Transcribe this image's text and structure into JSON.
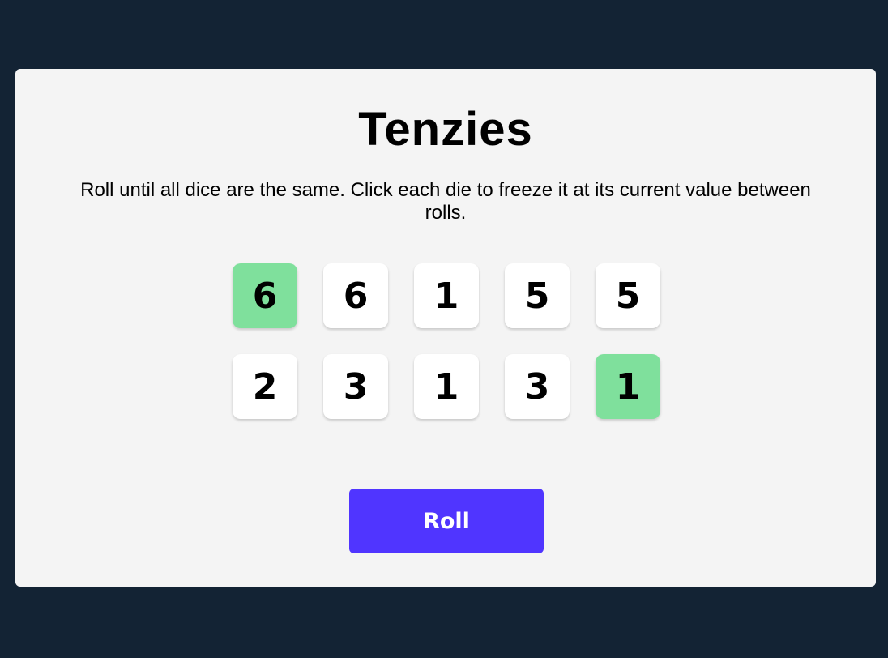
{
  "game": {
    "title": "Tenzies",
    "instructions": "Roll until all dice are the same. Click each die to freeze it at its current value between rolls.",
    "roll_label": "Roll"
  },
  "dice": [
    {
      "value": "6",
      "held": true
    },
    {
      "value": "6",
      "held": false
    },
    {
      "value": "1",
      "held": false
    },
    {
      "value": "5",
      "held": false
    },
    {
      "value": "5",
      "held": false
    },
    {
      "value": "2",
      "held": false
    },
    {
      "value": "3",
      "held": false
    },
    {
      "value": "1",
      "held": false
    },
    {
      "value": "3",
      "held": false
    },
    {
      "value": "1",
      "held": true
    }
  ],
  "colors": {
    "page_background": "#132334",
    "board_background": "#f4f4f4",
    "die_background": "#ffffff",
    "die_held_background": "#7fe09c",
    "roll_button_background": "#5035ff"
  }
}
